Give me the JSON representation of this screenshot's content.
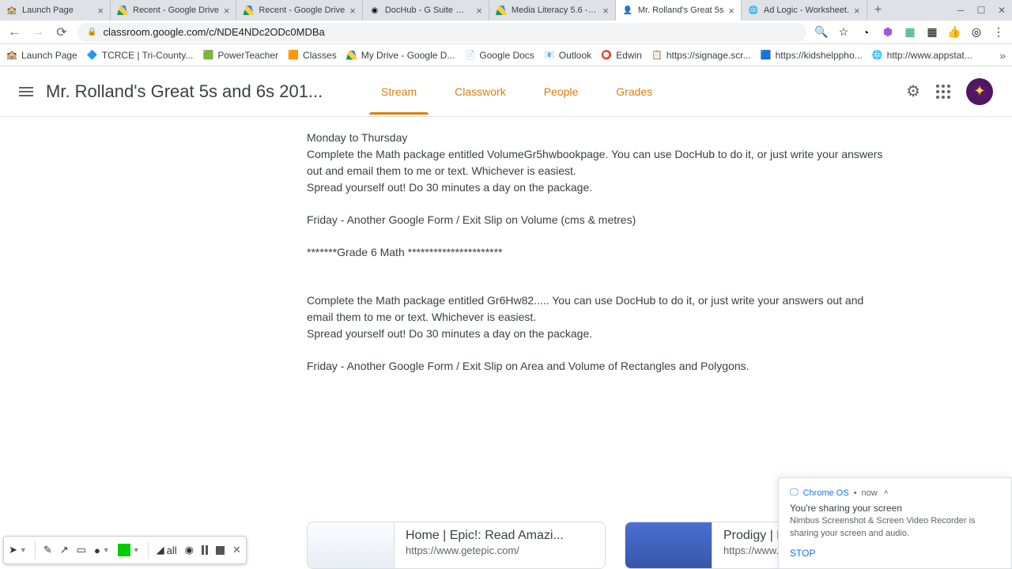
{
  "browser": {
    "tabs": [
      {
        "label": "Launch Page",
        "icon": "🏫"
      },
      {
        "label": "Recent - Google Drive",
        "icon": "drive"
      },
      {
        "label": "Recent - Google Drive",
        "icon": "drive"
      },
      {
        "label": "DocHub - G Suite Mark",
        "icon": "🔵"
      },
      {
        "label": "Media Literacy 5.6 - Go",
        "icon": "drive"
      },
      {
        "label": "Mr. Rolland's Great 5s",
        "icon": "🟧",
        "active": true
      },
      {
        "label": "Ad Logic - Worksheet.",
        "icon": "🌐"
      }
    ],
    "url": "classroom.google.com/c/NDE4NDc2ODc0MDBa",
    "bookmarks": [
      {
        "label": "Launch Page",
        "icon": "🏫"
      },
      {
        "label": "TCRCE | Tri-County...",
        "icon": "🔷"
      },
      {
        "label": "PowerTeacher",
        "icon": "🟩"
      },
      {
        "label": "Classes",
        "icon": "🟧"
      },
      {
        "label": "My Drive - Google D...",
        "icon": "drive"
      },
      {
        "label": "Google Docs",
        "icon": "📄"
      },
      {
        "label": "Outlook",
        "icon": "📧"
      },
      {
        "label": "Edwin",
        "icon": "⭕"
      },
      {
        "label": "https://signage.scr...",
        "icon": "📋"
      },
      {
        "label": "https://kidshelppho...",
        "icon": "🟦"
      },
      {
        "label": "http://www.appstat...",
        "icon": "🌐"
      }
    ]
  },
  "classroom": {
    "title": "Mr. Rolland's Great 5s and 6s 201...",
    "tabs": {
      "stream": "Stream",
      "classwork": "Classwork",
      "people": "People",
      "grades": "Grades"
    },
    "post": {
      "l1": "Monday to Thursday",
      "l2": "Complete the Math package entitled VolumeGr5hwbookpage. You can use DocHub to do it, or just write your answers out and email them to me or text. Whichever is easiest.",
      "l3": "Spread yourself out! Do 30 minutes a day on the package.",
      "l4": "Friday - Another Google Form / Exit Slip on Volume (cms & metres)",
      "l5": "*******Grade 6 Math **********************",
      "l6": "Complete the Math package entitled Gr6Hw82..... You can use DocHub to do it, or just write your answers out and email them to me or text. Whichever is easiest.",
      "l7": "Spread yourself out! Do 30 minutes a day on the package.",
      "l8": "Friday - Another Google Form / Exit Slip on Area and Volume of Rectangles and Polygons."
    },
    "links": [
      {
        "title": "Home | Epic!: Read Amazi...",
        "url": "https://www.getepic.com/"
      },
      {
        "title": "Prodigy | F...",
        "url": "https://www.prodigygame..."
      }
    ]
  },
  "notification": {
    "source": "Chrome OS",
    "when": "now",
    "title": "You're sharing your screen",
    "body": "Nimbus Screenshot & Screen Video Recorder is sharing your screen and audio.",
    "action": "STOP"
  },
  "recorder": {
    "eraser_label": "all"
  }
}
